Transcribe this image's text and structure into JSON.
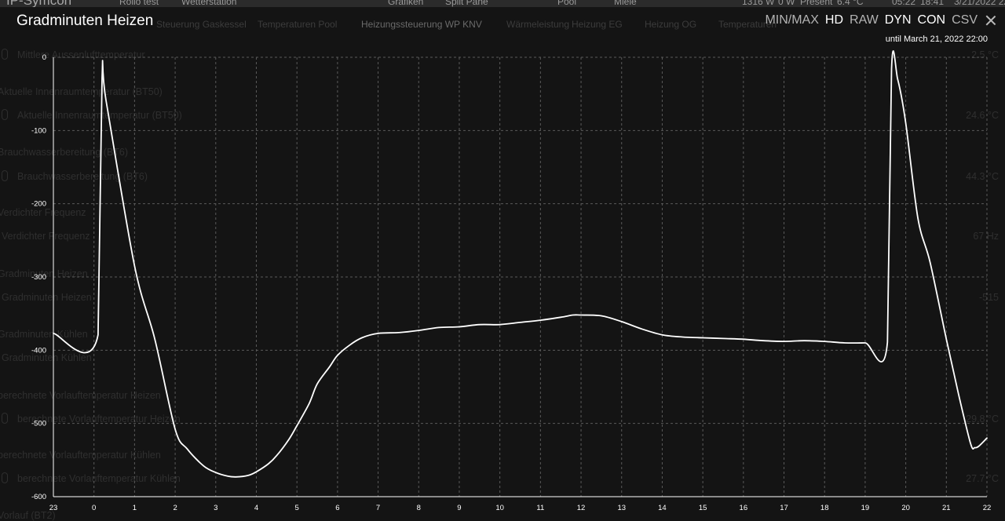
{
  "app": {
    "logo": "IP-Symcon"
  },
  "status_bar": {
    "items": [
      "1316 W",
      "0 W",
      "Present",
      "6.4 °C",
      "05:22",
      "18:41",
      "3/21/2022 22"
    ]
  },
  "tabs": [
    {
      "label": "Rollo test"
    },
    {
      "label": "Wetterstation"
    },
    {
      "label": "Grafiken"
    },
    {
      "label": "Split Pane"
    },
    {
      "label": "Pool"
    },
    {
      "label": "Miele"
    }
  ],
  "sub_tabs": [
    {
      "label": "Steuerung Gaskessel",
      "active": false
    },
    {
      "label": "Temperaturen Pool",
      "active": false
    },
    {
      "label": "Heizungssteuerung WP KNV",
      "active": true
    },
    {
      "label": "Wärmeleistung",
      "active": false
    },
    {
      "label": "Heizung EG",
      "active": false
    },
    {
      "label": "Heizung OG",
      "active": false
    },
    {
      "label": "Temperaturen",
      "active": false
    }
  ],
  "background_rows": [
    {
      "label": "Mittlere Aussenlufttemperatur",
      "value": "2.5 °C",
      "section": false
    },
    {
      "label": "Aktuelle Innenraumtemperatur (BT50)",
      "value": "",
      "section": true
    },
    {
      "label": "Aktuelle Innenraumtemperatur (BT50)",
      "value": "24.6 °C",
      "section": false
    },
    {
      "label": "Brauchwasserbereitung (BT6)",
      "value": "",
      "section": true
    },
    {
      "label": "Brauchwasserbereitung (BT6)",
      "value": "44.3 °C",
      "section": false
    },
    {
      "label": "Verdichter Frequenz",
      "value": "",
      "section": true
    },
    {
      "label": "Verdichter Frequenz",
      "value": "67 Hz",
      "section": false
    },
    {
      "label": "Gradminuten Heizen",
      "value": "",
      "section": true
    },
    {
      "label": "Gradminuten Heizen",
      "value": "-515",
      "section": false
    },
    {
      "label": "Gradminuten Kühlen",
      "value": "",
      "section": true
    },
    {
      "label": "Gradminuten Kühlen",
      "value": "",
      "section": false
    },
    {
      "label": "berechnete Vorlauftemperatur Heizen",
      "value": "",
      "section": true
    },
    {
      "label": "berechnete Vorlauftemperatur Heizen",
      "value": "29.8 °C",
      "section": false
    },
    {
      "label": "berechnete Vorlauftemperatur Kühlen",
      "value": "",
      "section": true
    },
    {
      "label": "berechnete Vorlauftemperatur Kühlen",
      "value": "27.7 °C",
      "section": false
    },
    {
      "label": "Vorlauf (BT2)",
      "value": "",
      "section": true
    }
  ],
  "overlay": {
    "title": "Gradminuten Heizen",
    "range_label": "until March 21, 2022 22:00",
    "toolbar": [
      {
        "label": "MIN/MAX",
        "active": false
      },
      {
        "label": "HD",
        "active": true
      },
      {
        "label": "RAW",
        "active": false
      },
      {
        "label": "DYN",
        "active": true
      },
      {
        "label": "CON",
        "active": true
      },
      {
        "label": "CSV",
        "active": false
      }
    ],
    "close_icon": "close-icon"
  },
  "colors": {
    "background": "#141414",
    "line": "#ffffff",
    "grid": "#5a5a5a"
  },
  "chart_data": {
    "type": "line",
    "title": "Gradminuten Heizen",
    "ylim": [
      -600,
      0
    ],
    "yticks": [
      0,
      -100,
      -200,
      -300,
      -400,
      -500,
      -600
    ],
    "xlim": [
      23,
      46
    ],
    "xticks": [
      23,
      24,
      25,
      26,
      27,
      28,
      29,
      30,
      31,
      32,
      33,
      34,
      35,
      36,
      37,
      38,
      39,
      40,
      41,
      42,
      43,
      44,
      45,
      46
    ],
    "xtick_labels": [
      "23",
      "0",
      "1",
      "2",
      "3",
      "4",
      "5",
      "6",
      "7",
      "8",
      "9",
      "10",
      "11",
      "12",
      "13",
      "14",
      "15",
      "16",
      "17",
      "18",
      "19",
      "20",
      "21",
      "22"
    ],
    "grid": true,
    "series": [
      {
        "x": [
          23.0,
          24.1,
          24.2,
          24.3,
          25.0,
          25.5,
          26.0,
          26.3,
          26.7,
          27.0,
          27.3,
          27.5,
          27.8,
          28.0,
          28.3,
          28.5,
          28.8,
          29.0,
          29.3,
          29.5,
          29.8,
          30.0,
          30.3,
          30.6,
          31.0,
          31.5,
          32.0,
          32.5,
          33.0,
          33.5,
          34.0,
          34.5,
          35.0,
          35.5,
          35.8,
          36.0,
          36.5,
          37.0,
          37.5,
          38.0,
          38.5,
          39.0,
          39.5,
          40.0,
          40.5,
          41.0,
          41.5,
          42.0,
          42.5,
          43.0,
          43.55,
          43.65,
          43.8,
          44.0,
          44.3,
          44.6,
          45.0,
          45.3,
          45.6,
          45.7,
          45.8,
          46.0
        ],
        "y": [
          -377,
          -379,
          -28,
          -60,
          -285,
          -385,
          -508,
          -535,
          -558,
          -567,
          -572,
          -573,
          -571,
          -566,
          -555,
          -544,
          -522,
          -503,
          -473,
          -446,
          -423,
          -407,
          -393,
          -383,
          -377,
          -376,
          -373,
          -369,
          -368,
          -365,
          -365,
          -362,
          -359,
          -355,
          -352,
          -352,
          -353,
          -361,
          -371,
          -379,
          -382,
          -383,
          -384,
          -385,
          -387,
          -388,
          -387,
          -388,
          -390,
          -390,
          -389,
          -16,
          -30,
          -90,
          -220,
          -280,
          -385,
          -460,
          -528,
          -533,
          -531,
          -520
        ]
      }
    ]
  }
}
